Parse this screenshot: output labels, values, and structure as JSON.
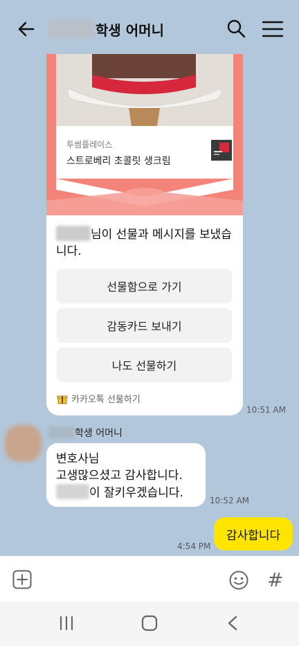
{
  "header": {
    "title_suffix": "학생 어머니"
  },
  "gift": {
    "brand": "투썸플레이스",
    "product": "스트로베리 초콜릿 생크림",
    "message": "님이 선물과 메시지를 보냈습니다.",
    "buttons": [
      "선물함으로 가기",
      "감동카드 보내기",
      "나도 선물하기"
    ],
    "footer": "카카오톡 선물하기",
    "time": "10:51 AM"
  },
  "incoming": {
    "sender_suffix": "학생 어머니",
    "line1": "변호사님",
    "line2": "고생많으셨고 감사합니다.",
    "line3_suffix": "이 잘키우겠습니다.",
    "time": "10:52 AM"
  },
  "outgoing": {
    "text": "감사합니다",
    "time": "4:54 PM"
  },
  "colors": {
    "chat_bg": "#b2c7da",
    "my_bubble": "#fee500",
    "gift_accent": "#f4847a"
  }
}
